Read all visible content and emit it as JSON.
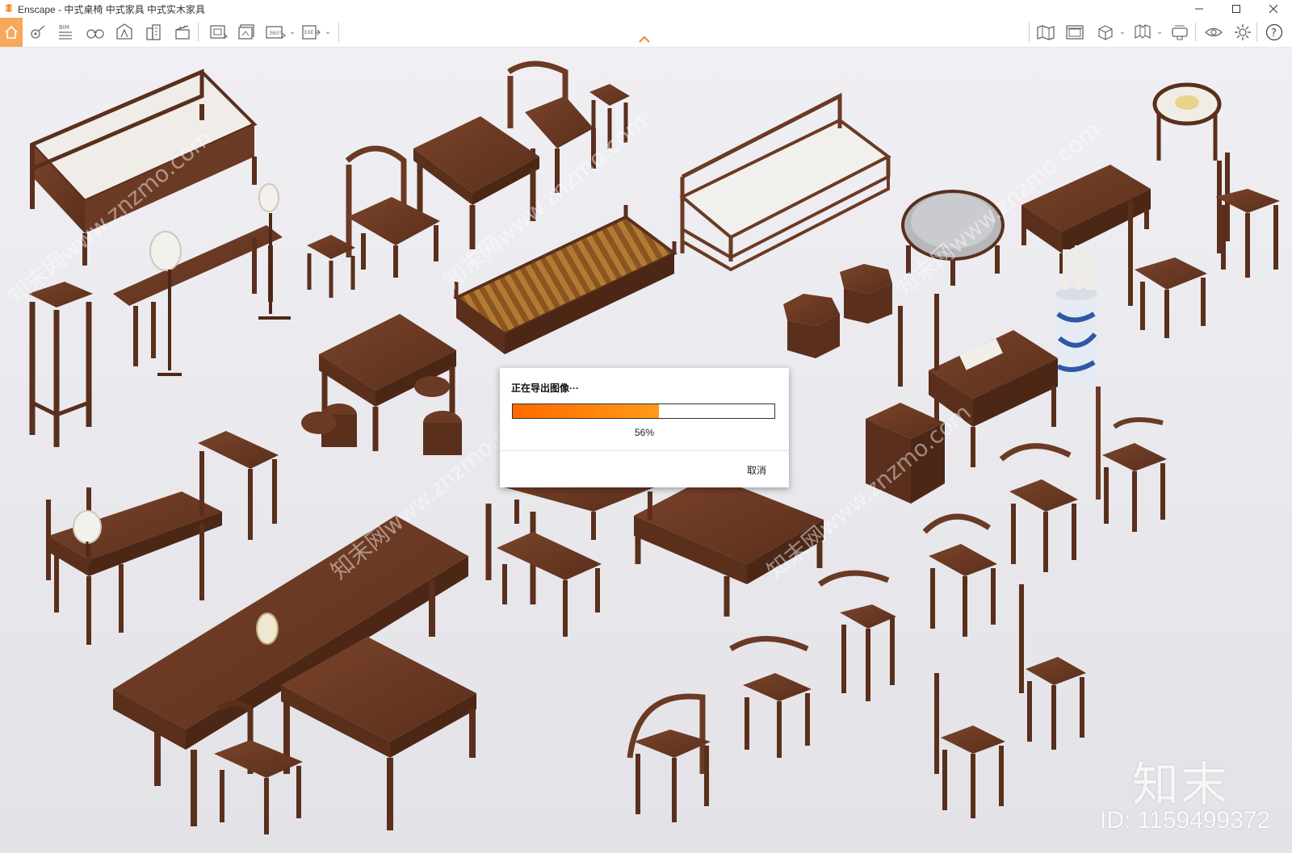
{
  "window": {
    "app_name": "Enscape",
    "title": "Enscape - 中式桌椅 中式家具 中式实木家具",
    "controls": [
      "minimize",
      "maximize",
      "close"
    ]
  },
  "toolbar": {
    "left_tools": [
      {
        "name": "home-icon",
        "active": true
      },
      {
        "name": "views-icon"
      },
      {
        "name": "bim-icon",
        "label": "BIM"
      },
      {
        "name": "binoculars-icon"
      },
      {
        "name": "asset-library-icon"
      },
      {
        "name": "buildings-icon"
      },
      {
        "name": "clapperboard-icon"
      },
      {
        "name": "screenshot-icon"
      },
      {
        "name": "batch-render-icon"
      },
      {
        "name": "panorama-360-icon",
        "label": "360°"
      },
      {
        "name": "export-icon",
        "label": "EXE"
      }
    ],
    "right_tools": [
      {
        "name": "map-icon"
      },
      {
        "name": "web-standalone-icon"
      },
      {
        "name": "cube-icon"
      },
      {
        "name": "book-icon"
      },
      {
        "name": "vr-headset-icon"
      },
      {
        "name": "eye-icon"
      },
      {
        "name": "gear-icon"
      },
      {
        "name": "help-icon",
        "label": "?"
      }
    ]
  },
  "dialog": {
    "title": "正在导出图像···",
    "progress_percent": 56,
    "progress_label": "56%",
    "cancel_label": "取消"
  },
  "watermark": {
    "logo_text": "知末",
    "id_text": "ID: 1159499372",
    "diagonal_text": "知末网www.znzmo.com"
  },
  "colors": {
    "accent": "#f7a95a",
    "progress_start": "#ff6a00",
    "progress_end": "#ff9a1a",
    "wood": "#6b3a24",
    "floor": "#e9e8ec"
  }
}
